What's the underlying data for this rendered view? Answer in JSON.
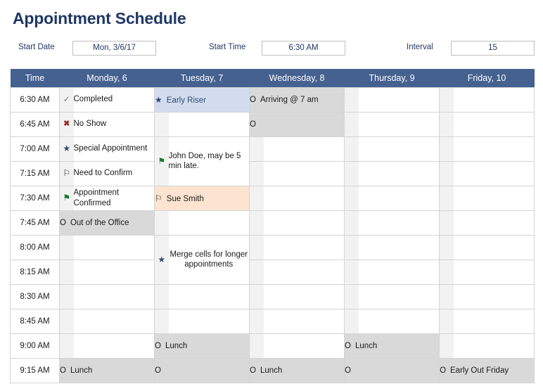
{
  "header": {
    "title": "Appointment Schedule"
  },
  "form": {
    "start_date": {
      "label": "Start Date",
      "value": "Mon, 3/6/17"
    },
    "start_time": {
      "label": "Start Time",
      "value": "6:30 AM"
    },
    "interval": {
      "label": "Interval",
      "value": "15"
    }
  },
  "grid": {
    "columns": [
      {
        "key": "time",
        "label": "Time"
      },
      {
        "key": "monday",
        "label": "Monday, 6"
      },
      {
        "key": "tuesday",
        "label": "Tuesday, 7"
      },
      {
        "key": "wednesday",
        "label": "Wednesday, 8"
      },
      {
        "key": "thursday",
        "label": "Thursday, 9"
      },
      {
        "key": "friday",
        "label": "Friday, 10"
      }
    ],
    "times": [
      "6:30 AM",
      "6:45 AM",
      "7:00 AM",
      "7:15 AM",
      "7:30 AM",
      "7:45 AM",
      "8:00 AM",
      "8:15 AM",
      "8:30 AM",
      "8:45 AM",
      "9:00 AM",
      "9:15 AM"
    ],
    "cells": {
      "mon_0": {
        "icon": "check",
        "text": "Completed"
      },
      "mon_1": {
        "icon": "x",
        "text": "No Show"
      },
      "mon_2": {
        "icon": "star",
        "text": "Special Appointment"
      },
      "mon_3": {
        "icon": "flag-outline",
        "text": "Need to Confirm"
      },
      "mon_4": {
        "icon": "flag-filled",
        "text": "Appointment Confirmed"
      },
      "mon_5": {
        "icon": "circle",
        "text": "Out of the Office"
      },
      "mon_11": {
        "icon": "circle",
        "text": "Lunch"
      },
      "tue_0": {
        "icon": "star",
        "text": "Early Riser"
      },
      "tue_2": {
        "icon": "flag-filled",
        "text": "John Doe, may be 5 min late."
      },
      "tue_4": {
        "icon": "flag-outline",
        "text": "Sue Smith"
      },
      "tue_6": {
        "icon": "star",
        "text": "Merge cells for longer appointments"
      },
      "tue_10": {
        "icon": "circle",
        "text": "Lunch"
      },
      "tue_11": {
        "icon": "circle",
        "text": ""
      },
      "wed_0": {
        "icon": "circle",
        "text": "Arriving @ 7 am"
      },
      "wed_1": {
        "icon": "circle",
        "text": ""
      },
      "wed_11": {
        "icon": "circle",
        "text": "Lunch"
      },
      "thu_10": {
        "icon": "circle",
        "text": "Lunch"
      },
      "thu_11": {
        "icon": "circle",
        "text": ""
      },
      "fri_11": {
        "icon": "circle",
        "text": "Early Out Friday"
      }
    }
  },
  "icons": {
    "check": "✓",
    "x": "✖",
    "star": "★",
    "flag-outline": "⚐",
    "flag-filled": "⚑",
    "circle": "O"
  },
  "colors": {
    "header_blue": "#44618f",
    "title_navy": "#1f3864",
    "completed_gray": "#808080",
    "noshow_pink": "#f2dcdb",
    "special_blue": "#d3dcef",
    "confirm_peach": "#fce4d0",
    "confirmed_green": "#d6f0d6",
    "outofoffice_gray": "#d9d9d9"
  }
}
